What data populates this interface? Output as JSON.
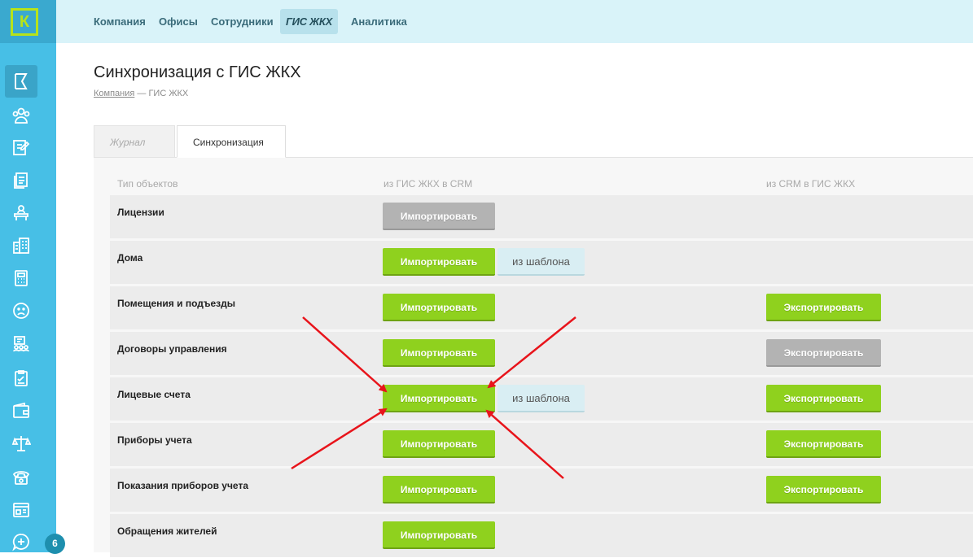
{
  "sidebar": {
    "logo_text": "К",
    "icons": [
      "flag-icon",
      "users-group-icon",
      "edit-note-icon",
      "documents-icon",
      "desk-person-icon",
      "buildings-icon",
      "calculator-icon",
      "sad-face-icon",
      "staff-icon",
      "checklist-icon",
      "wallet-icon",
      "scales-icon",
      "phone-icon",
      "news-icon",
      "chat-add-icon"
    ],
    "badge_count": "6"
  },
  "nav": {
    "items": [
      "Компания",
      "Офисы",
      "Сотрудники",
      "ГИС ЖКХ",
      "Аналитика"
    ],
    "active_index": 3
  },
  "page": {
    "title": "Синхронизация с ГИС ЖКХ",
    "breadcrumb_link": "Компания",
    "breadcrumb_current": " — ГИС ЖКХ"
  },
  "tabs": {
    "journal": "Журнал",
    "journal_icon": "↻",
    "sync": "Синхронизация"
  },
  "table": {
    "headers": [
      "Тип объектов",
      "из ГИС ЖКХ в CRM",
      "из CRM в ГИС ЖКХ"
    ],
    "import_label": "Импортировать",
    "export_label": "Экспортировать",
    "template_label": "из шаблона",
    "rows": [
      {
        "name": "Лицензии",
        "import_state": "disabled",
        "template": false,
        "export_state": "none"
      },
      {
        "name": "Дома",
        "import_state": "enabled",
        "template": true,
        "export_state": "none"
      },
      {
        "name": "Помещения и подъезды",
        "import_state": "enabled",
        "template": false,
        "export_state": "enabled"
      },
      {
        "name": "Договоры управления",
        "import_state": "enabled",
        "template": false,
        "export_state": "disabled"
      },
      {
        "name": "Лицевые счета",
        "import_state": "enabled",
        "template": true,
        "export_state": "enabled"
      },
      {
        "name": "Приборы учета",
        "import_state": "enabled",
        "template": false,
        "export_state": "enabled"
      },
      {
        "name": "Показания приборов учета",
        "import_state": "enabled",
        "template": false,
        "export_state": "enabled"
      },
      {
        "name": "Обращения жителей",
        "import_state": "enabled",
        "template": false,
        "export_state": "none"
      }
    ]
  },
  "colors": {
    "sidebar": "#47bfe6",
    "topbar": "#d9f3f9",
    "green_button": "#8fd11e",
    "gray_button": "#b3b3b3",
    "arrow": "#e8141b"
  }
}
